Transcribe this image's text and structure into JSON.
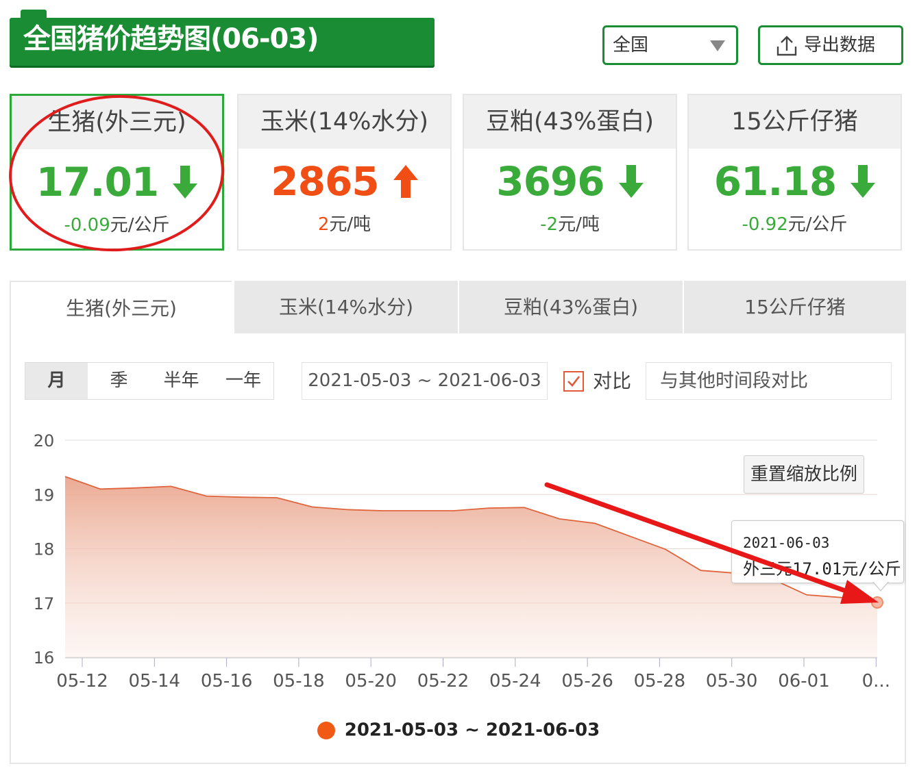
{
  "header": {
    "title": "全国猪价趋势图(06-03)",
    "region_value": "全国",
    "export_label": "导出数据"
  },
  "cards": [
    {
      "name": "生猪(外三元)",
      "value": "17.01",
      "direction": "down",
      "change": "-0.09",
      "unit": "元/公斤",
      "color": "#3aab3a",
      "active": true
    },
    {
      "name": "玉米(14%水分)",
      "value": "2865",
      "direction": "up",
      "change": "2",
      "unit": "元/吨",
      "color": "#f04e14",
      "active": false
    },
    {
      "name": "豆粕(43%蛋白)",
      "value": "3696",
      "direction": "down",
      "change": "-2",
      "unit": "元/吨",
      "color": "#3aab3a",
      "active": false
    },
    {
      "name": "15公斤仔猪",
      "value": "61.18",
      "direction": "down",
      "change": "-0.92",
      "unit": "元/公斤",
      "color": "#3aab3a",
      "active": false
    }
  ],
  "tabs": [
    "生猪(外三元)",
    "玉米(14%水分)",
    "豆粕(43%蛋白)",
    "15公斤仔猪"
  ],
  "range": {
    "options": [
      "月",
      "季",
      "半年",
      "一年"
    ],
    "selected": "月",
    "date_range": "2021-05-03 ~ 2021-06-03",
    "compare_label": "对比",
    "compare_checked": true,
    "compare_placeholder": "与其他时间段对比"
  },
  "chart": {
    "reset_label": "重置缩放比例",
    "tooltip_date": "2021-06-03",
    "tooltip_value": "外三元17.01元/公斤"
  },
  "chart_data": {
    "type": "area",
    "title": "",
    "xlabel": "",
    "ylabel": "",
    "ylim": [
      16,
      20
    ],
    "y_ticks": [
      20,
      19,
      18,
      17,
      16
    ],
    "x_tick_labels": [
      "05-12",
      "05-14",
      "05-16",
      "05-18",
      "05-20",
      "05-22",
      "05-24",
      "05-26",
      "05-28",
      "05-30",
      "06-01",
      "0..."
    ],
    "grid": true,
    "legend_position": "bottom-center",
    "series": [
      {
        "name": "2021-05-03 ~ 2021-06-03",
        "color": "#f05a14",
        "points": [
          [
            "05-11",
            19.33
          ],
          [
            "05-12",
            19.1
          ],
          [
            "05-13",
            19.12
          ],
          [
            "05-14",
            19.15
          ],
          [
            "05-15",
            18.97
          ],
          [
            "05-16",
            18.95
          ],
          [
            "05-17",
            18.94
          ],
          [
            "05-18",
            18.77
          ],
          [
            "05-19",
            18.72
          ],
          [
            "05-20",
            18.7
          ],
          [
            "05-21",
            18.7
          ],
          [
            "05-22",
            18.7
          ],
          [
            "05-23",
            18.75
          ],
          [
            "05-24",
            18.76
          ],
          [
            "05-25",
            18.55
          ],
          [
            "05-26",
            18.47
          ],
          [
            "05-27",
            18.23
          ],
          [
            "05-28",
            17.99
          ],
          [
            "05-29",
            17.6
          ],
          [
            "05-30",
            17.55
          ],
          [
            "05-31",
            17.45
          ],
          [
            "06-01",
            17.15
          ],
          [
            "06-02",
            17.1
          ],
          [
            "06-03",
            17.01
          ]
        ]
      }
    ]
  }
}
